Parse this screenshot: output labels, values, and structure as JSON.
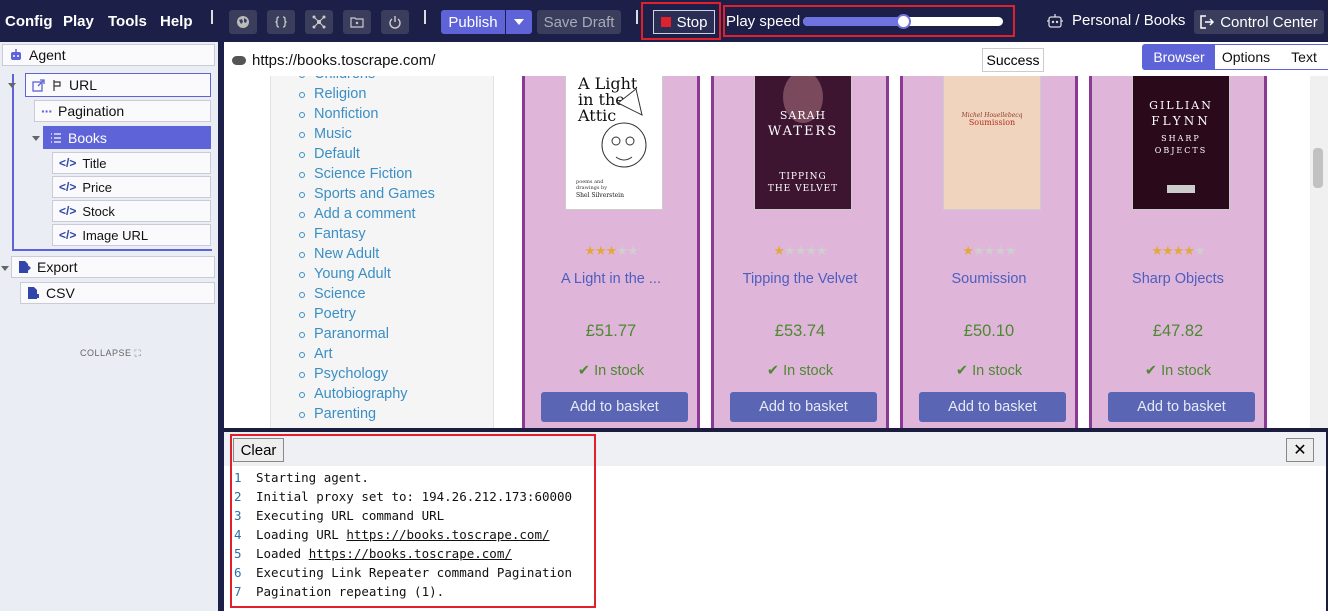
{
  "menu": [
    "Config",
    "Play",
    "Tools",
    "Help"
  ],
  "toolbar": {
    "publish_label": "Publish",
    "save_draft_label": "Save Draft",
    "stop_label": "Stop",
    "play_speed_label": "Play speed",
    "play_speed_value": 0.5,
    "workspace_label": "Personal / Books",
    "control_center_label": "Control Center"
  },
  "agent_tree": {
    "agent_label": "Agent",
    "url_label": "URL",
    "pagination_label": "Pagination",
    "books_label": "Books",
    "fields": [
      "Title",
      "Price",
      "Stock",
      "Image URL"
    ],
    "export_label": "Export",
    "csv_label": "CSV",
    "collapse_label": "COLLAPSE"
  },
  "browser": {
    "url": "https://books.toscrape.com/",
    "status": "Success",
    "tabs": [
      "Browser",
      "Options",
      "Text"
    ],
    "active_tab": "Browser"
  },
  "categories": [
    "Childrens",
    "Religion",
    "Nonfiction",
    "Music",
    "Default",
    "Science Fiction",
    "Sports and Games",
    "Add a comment",
    "Fantasy",
    "New Adult",
    "Young Adult",
    "Science",
    "Poetry",
    "Paranormal",
    "Art",
    "Psychology",
    "Autobiography",
    "Parenting"
  ],
  "products": [
    {
      "title": "A Light in the ...",
      "price": "£51.77",
      "rating": 3,
      "stock": "In stock",
      "button": "Add to basket",
      "cover": {
        "line1": "A Light",
        "line2": "in the",
        "line3": "Attic",
        "footer1": "poems and",
        "footer2": "drawings by",
        "footer3": "Shel Silverstein"
      }
    },
    {
      "title": "Tipping the Velvet",
      "price": "£53.74",
      "rating": 1,
      "stock": "In stock",
      "button": "Add to basket",
      "cover": {
        "line1": "SARAH",
        "line2": "WATERS",
        "line3": "TIPPING",
        "line4": "THE VELVET"
      }
    },
    {
      "title": "Soumission",
      "price": "£50.10",
      "rating": 1,
      "stock": "In stock",
      "button": "Add to basket",
      "cover": {
        "line1": "Michel Houellebecq",
        "line2": "Soumission"
      }
    },
    {
      "title": "Sharp Objects",
      "price": "£47.82",
      "rating": 4,
      "stock": "In stock",
      "button": "Add to basket",
      "cover": {
        "line1": "GILLIAN",
        "line2": "FLYNN",
        "line3": "SHARP",
        "line4": "OBJECTS"
      }
    }
  ],
  "log": {
    "clear_label": "Clear",
    "close_label": "✕",
    "lines": [
      {
        "num": "1",
        "text": "Starting agent.",
        "link": ""
      },
      {
        "num": "2",
        "text": "Initial proxy set to: 194.26.212.173:60000",
        "link": ""
      },
      {
        "num": "3",
        "text": "Executing URL command URL",
        "link": ""
      },
      {
        "num": "4",
        "text": "Loading URL ",
        "link": "https://books.toscrape.com/"
      },
      {
        "num": "5",
        "text": "Loaded ",
        "link": "https://books.toscrape.com/"
      },
      {
        "num": "6",
        "text": "Executing Link Repeater command Pagination",
        "link": ""
      },
      {
        "num": "7",
        "text": "Pagination repeating (1).",
        "link": ""
      }
    ]
  },
  "colors": {
    "accent": "#5e63d8",
    "toolbar_bg": "#1c1f47",
    "highlight_red": "#e0202a",
    "card_bg": "#e0b5da"
  }
}
